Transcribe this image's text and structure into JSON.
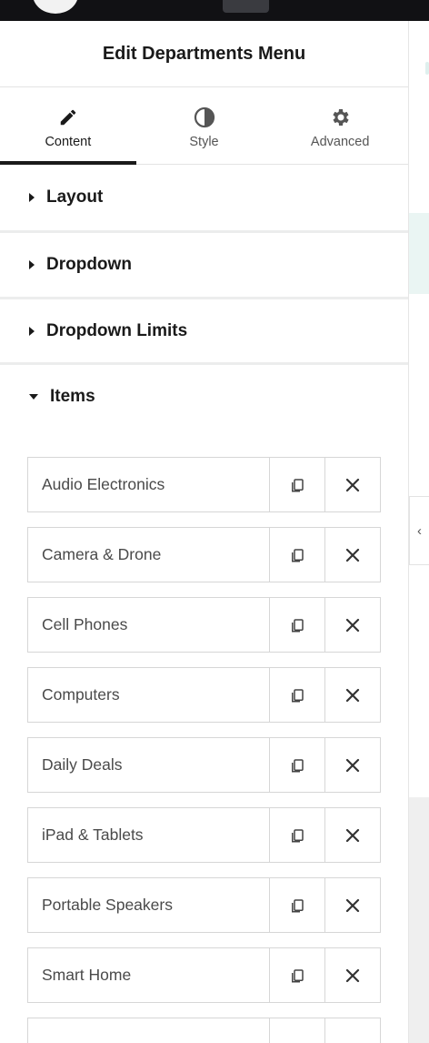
{
  "panel": {
    "title": "Edit Departments Menu"
  },
  "tabs": [
    {
      "label": "Content",
      "icon": "pencil-icon",
      "active": true
    },
    {
      "label": "Style",
      "icon": "contrast-icon",
      "active": false
    },
    {
      "label": "Advanced",
      "icon": "gear-icon",
      "active": false
    }
  ],
  "sections": {
    "layout": "Layout",
    "dropdown": "Dropdown",
    "dropdown_limits": "Dropdown Limits",
    "items": "Items"
  },
  "items": [
    {
      "label": "Audio Electronics"
    },
    {
      "label": "Camera & Drone"
    },
    {
      "label": "Cell Phones"
    },
    {
      "label": "Computers"
    },
    {
      "label": "Daily Deals"
    },
    {
      "label": "iPad & Tablets"
    },
    {
      "label": "Portable Speakers"
    },
    {
      "label": "Smart Home"
    },
    {
      "label": ""
    }
  ],
  "collapse_glyph": "‹",
  "colors": {
    "accent": "#1a1a1a",
    "muted_text": "#4a4a4a",
    "border": "#d6d6d6"
  }
}
